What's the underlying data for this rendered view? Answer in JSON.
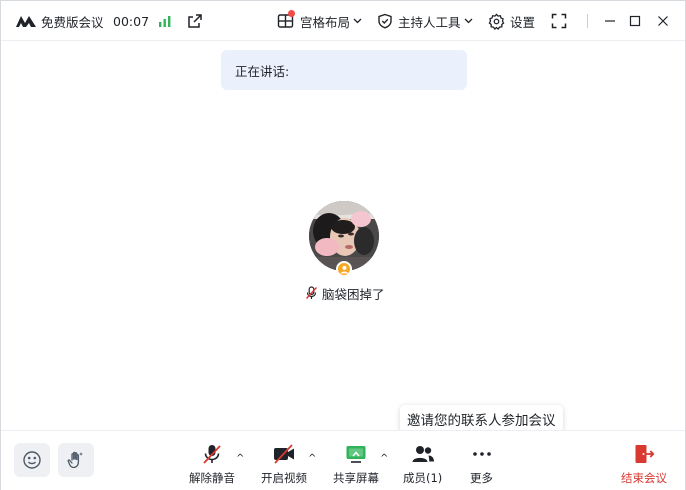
{
  "titlebar": {
    "app_name": "免费版会议",
    "timer": "00:07",
    "layout_label": "宫格布局",
    "host_tools_label": "主持人工具",
    "settings_label": "设置"
  },
  "speaking": {
    "label": "正在讲话:"
  },
  "participant": {
    "name": "脑袋困掉了",
    "muted": true,
    "is_host": true
  },
  "tooltip": {
    "text": "邀请您的联系人参加会议"
  },
  "toolbar": {
    "unmute_label": "解除静音",
    "start_video_label": "开启视频",
    "share_screen_label": "共享屏幕",
    "members_label": "成员(1)",
    "more_label": "更多",
    "end_label": "结束会议"
  },
  "colors": {
    "accent_green": "#2fb45a",
    "danger_red": "#d83931",
    "host_badge": "#f5a623",
    "speaking_bg": "#eaf0fc"
  },
  "icons": [
    "logo-icon",
    "signal-icon",
    "external-link-icon",
    "grid-layout-icon",
    "shield-icon",
    "gear-icon",
    "fullscreen-icon",
    "minimize-icon",
    "maximize-icon",
    "close-icon",
    "mic-off-icon",
    "video-off-icon",
    "share-screen-icon",
    "members-icon",
    "more-icon",
    "exit-icon",
    "emoji-icon",
    "raise-hand-icon",
    "host-icon"
  ]
}
